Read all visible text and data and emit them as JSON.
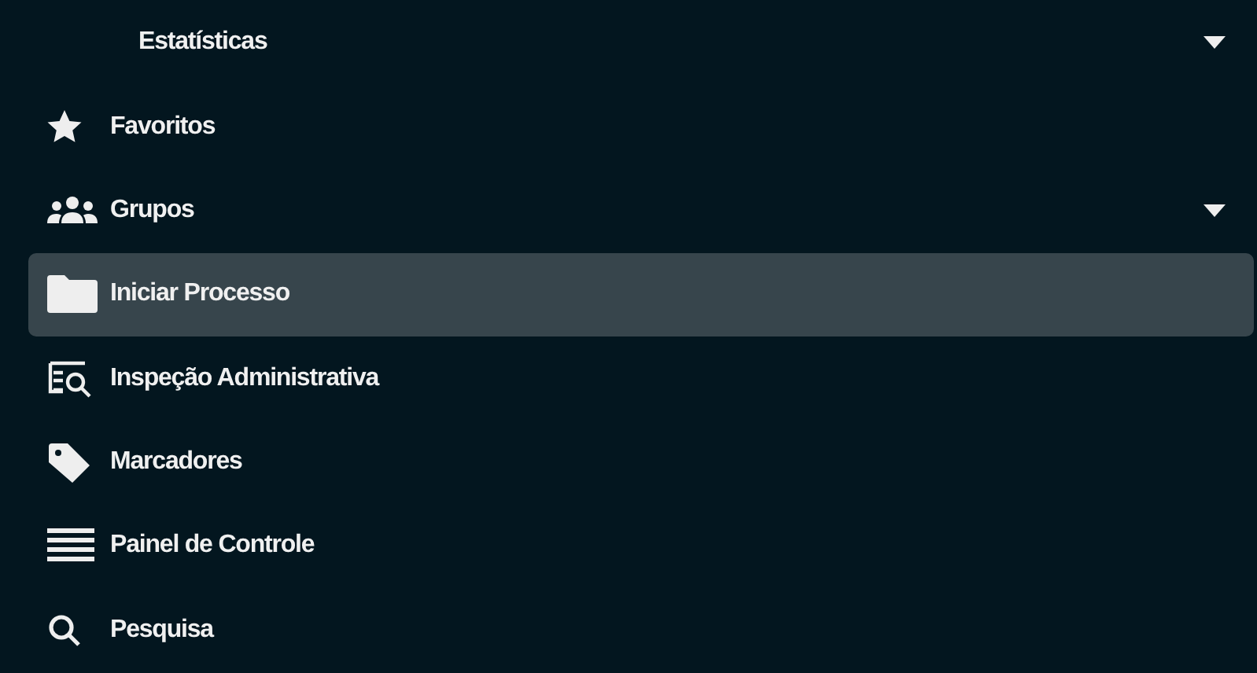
{
  "menu": [
    {
      "label": "Estatísticas",
      "kind": "subitem",
      "selected": false,
      "expandable": true
    },
    {
      "label": "Favoritos",
      "kind": "star",
      "selected": false,
      "expandable": false
    },
    {
      "label": "Grupos",
      "kind": "users",
      "selected": false,
      "expandable": true
    },
    {
      "label": "Iniciar Processo",
      "kind": "folder",
      "selected": true,
      "expandable": false
    },
    {
      "label": "Inspeção Administrativa",
      "kind": "search-doc",
      "selected": false,
      "expandable": false
    },
    {
      "label": "Marcadores",
      "kind": "tag",
      "selected": false,
      "expandable": false
    },
    {
      "label": "Painel de Controle",
      "kind": "list",
      "selected": false,
      "expandable": false
    },
    {
      "label": "Pesquisa",
      "kind": "search",
      "selected": false,
      "expandable": false
    }
  ]
}
